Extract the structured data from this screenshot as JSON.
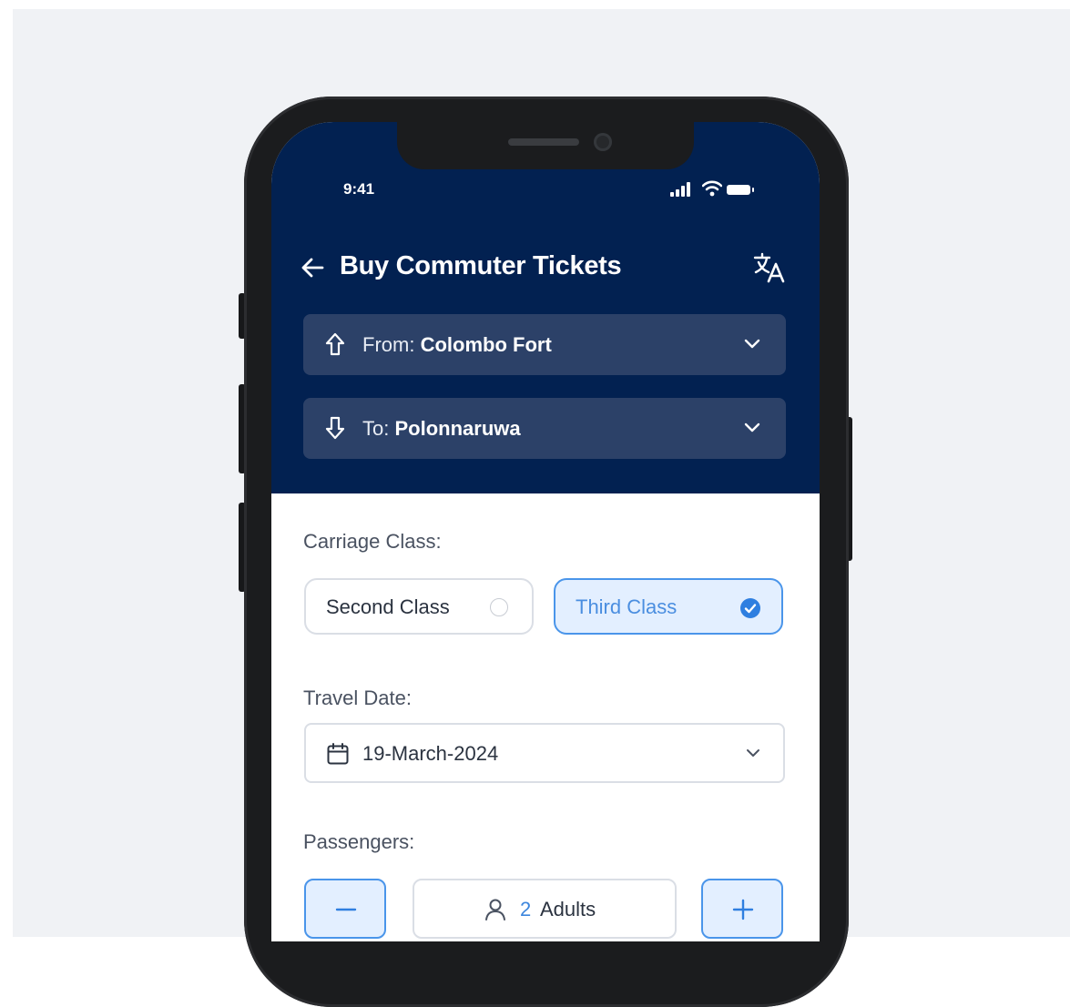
{
  "status_bar": {
    "time": "9:41"
  },
  "header": {
    "title": "Buy Commuter Tickets",
    "back_icon": "arrow-left-icon",
    "translate_icon": "translate-icon",
    "background_color": "#022151"
  },
  "route": {
    "from_label": "From:",
    "from_value": "Colombo Fort",
    "to_label": "To:",
    "to_value": "Polonnaruwa"
  },
  "carriage_class": {
    "label": "Carriage Class:",
    "options": [
      {
        "label": "Second Class",
        "selected": false
      },
      {
        "label": "Third Class",
        "selected": true
      }
    ]
  },
  "travel_date": {
    "label": "Travel Date:",
    "value": "19-March-2024"
  },
  "passengers": {
    "label": "Passengers:",
    "count": "2",
    "unit": "Adults"
  },
  "colors": {
    "accent": "#4a95ea",
    "accent_bg": "#e3efff",
    "field_dark": "#2c4168"
  }
}
